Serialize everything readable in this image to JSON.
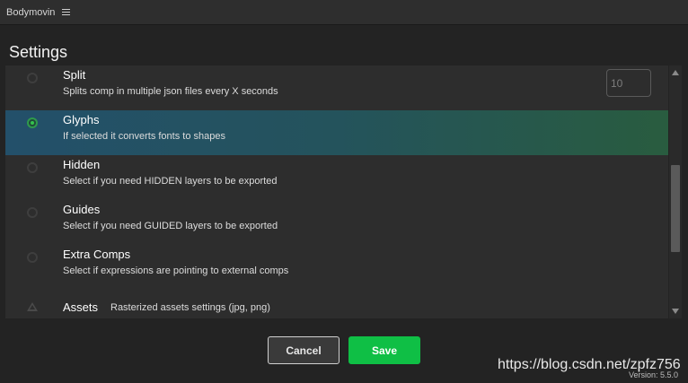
{
  "window": {
    "title": "Bodymovin",
    "menu_icon": "hamburger-menu-icon"
  },
  "heading": "Settings",
  "settings": [
    {
      "id": "split",
      "title": "Split",
      "description": "Splits comp in multiple json files every X seconds",
      "selected": false,
      "input_value": "10"
    },
    {
      "id": "glyphs",
      "title": "Glyphs",
      "description": "If selected it converts fonts to shapes",
      "selected": true
    },
    {
      "id": "hidden",
      "title": "Hidden",
      "description": "Select if you need HIDDEN layers to be exported",
      "selected": false
    },
    {
      "id": "guides",
      "title": "Guides",
      "description": "Select if you need GUIDED layers to be exported",
      "selected": false
    },
    {
      "id": "extra-comps",
      "title": "Extra Comps",
      "description": "Select if expressions are pointing to external comps",
      "selected": false
    }
  ],
  "assets": {
    "title": "Assets",
    "description": "Rasterized assets settings (jpg, png)",
    "icon": "triangle-expand-icon"
  },
  "scrollbar": {
    "position_fraction": 0.62,
    "visible_fraction": 0.38
  },
  "buttons": {
    "cancel_label": "Cancel",
    "save_label": "Save"
  },
  "colors": {
    "accent_green": "#0fbf45",
    "selected_row_start": "#23506a",
    "selected_row_end": "#295c3f",
    "background": "#232323"
  },
  "watermark": "https://blog.csdn.net/zpfz756",
  "version": "Version: 5.5.0"
}
